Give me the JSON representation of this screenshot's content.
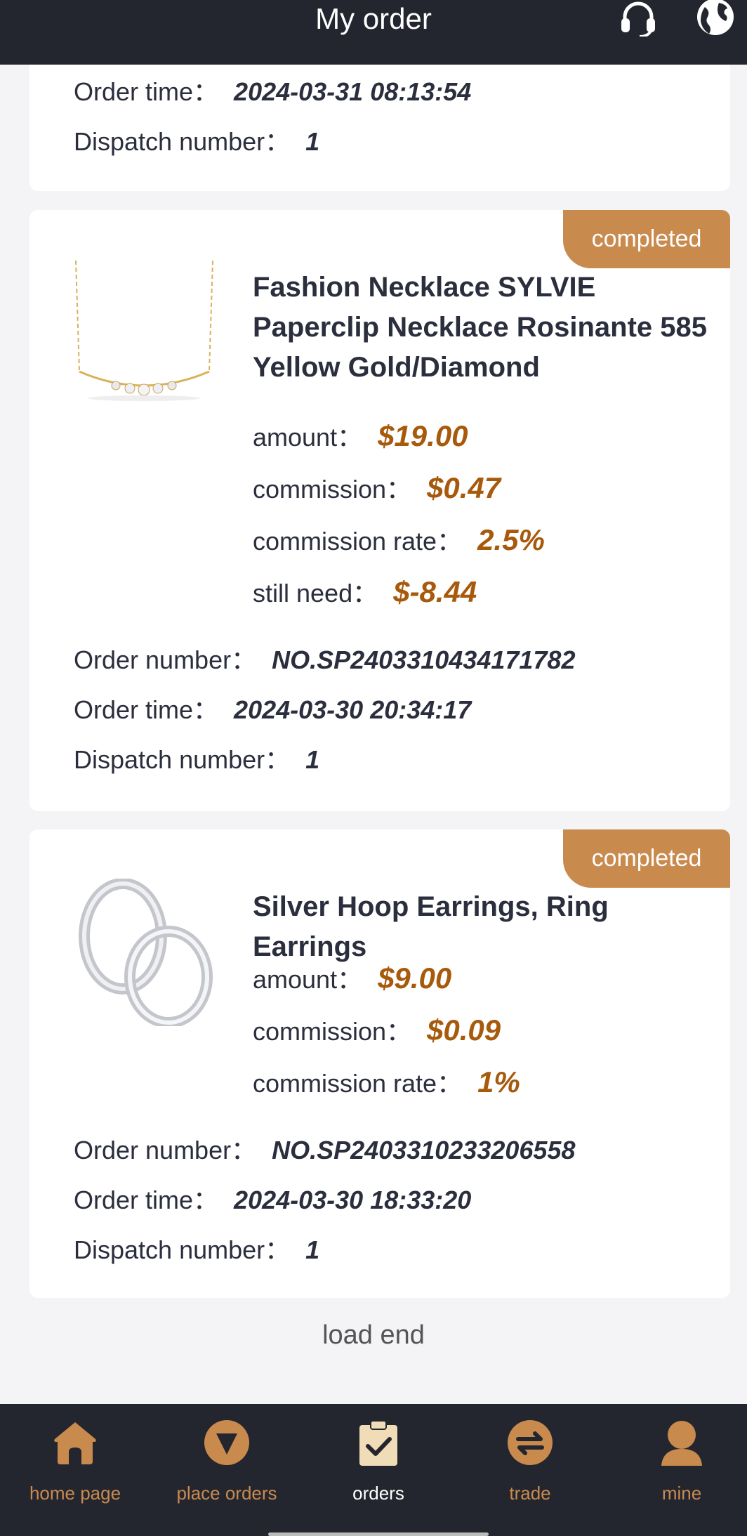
{
  "header": {
    "title": "My order",
    "support_icon": "headset-icon",
    "language_icon": "globe-icon"
  },
  "colors": {
    "accent": "#c98a4e",
    "value_gold": "#a7590c",
    "dark_bg": "#24262f"
  },
  "orders": [
    {
      "order_time_label": "Order time：",
      "order_time": "2024-03-31 08:13:54",
      "dispatch_label": "Dispatch number：",
      "dispatch": "1"
    },
    {
      "status": "completed",
      "product_name": "Fashion Necklace SYLVIE Paperclip Necklace Rosinante 585 Yellow Gold/Diamond",
      "amount_label": "amount：",
      "amount": "$19.00",
      "commission_label": "commission：",
      "commission": "$0.47",
      "rate_label": "commission rate：",
      "rate": "2.5%",
      "need_label": "still need：",
      "need": "$-8.44",
      "order_number_label": "Order number：",
      "order_number": "NO.SP2403310434171782",
      "order_time_label": "Order time：",
      "order_time": "2024-03-30 20:34:17",
      "dispatch_label": "Dispatch number：",
      "dispatch": "1"
    },
    {
      "status": "completed",
      "product_name": "Silver Hoop Earrings, Ring Earrings",
      "amount_label": "amount：",
      "amount": "$9.00",
      "commission_label": "commission：",
      "commission": "$0.09",
      "rate_label": "commission rate：",
      "rate": "1%",
      "order_number_label": "Order number：",
      "order_number": "NO.SP2403310233206558",
      "order_time_label": "Order time：",
      "order_time": "2024-03-30 18:33:20",
      "dispatch_label": "Dispatch number：",
      "dispatch": "1"
    }
  ],
  "load_end": "load end",
  "nav": [
    {
      "label": "home page",
      "icon": "home-icon"
    },
    {
      "label": "place orders",
      "icon": "place-orders-icon"
    },
    {
      "label": "orders",
      "icon": "orders-clipboard-icon",
      "active": true
    },
    {
      "label": "trade",
      "icon": "trade-icon"
    },
    {
      "label": "mine",
      "icon": "user-icon"
    }
  ]
}
